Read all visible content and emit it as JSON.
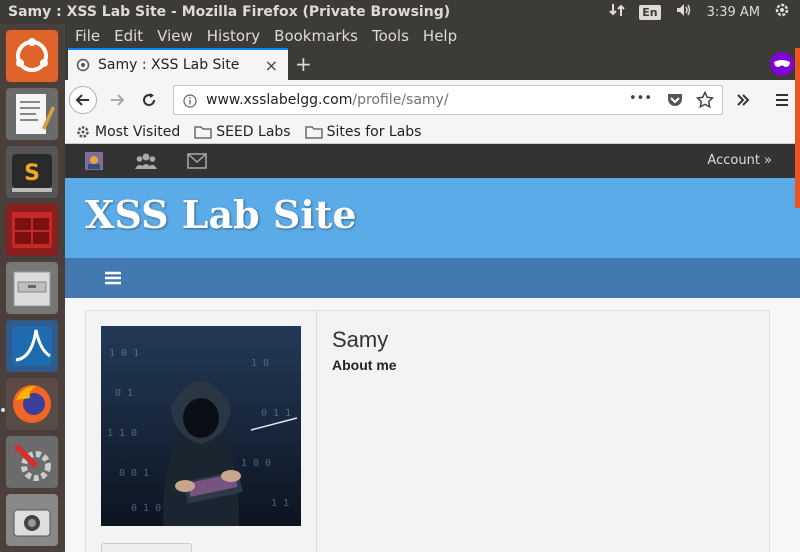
{
  "system": {
    "window_title": "Samy : XSS Lab Site - Mozilla Firefox (Private Browsing)",
    "language": "En",
    "clock": "3:39 AM"
  },
  "menubar": {
    "items": [
      "File",
      "Edit",
      "View",
      "History",
      "Bookmarks",
      "Tools",
      "Help"
    ]
  },
  "tabs": {
    "active_title": "Samy : XSS Lab Site",
    "close_glyph": "×",
    "new_tab_glyph": "+"
  },
  "urlbar": {
    "host": "www.xsslabelgg.com",
    "path": "/profile/samy/",
    "more_glyph": "•••"
  },
  "bookmarks": {
    "items": [
      "Most Visited",
      "SEED Labs",
      "Sites for Labs"
    ]
  },
  "site": {
    "account_label": "Account  »",
    "title": "XSS Lab Site"
  },
  "profile": {
    "name": "Samy",
    "about_label": "About me"
  },
  "colors": {
    "header_blue": "#5babe8",
    "nav_blue": "#4478b0",
    "private_purple": "#8000d7",
    "ubuntu_orange": "#e95420"
  }
}
